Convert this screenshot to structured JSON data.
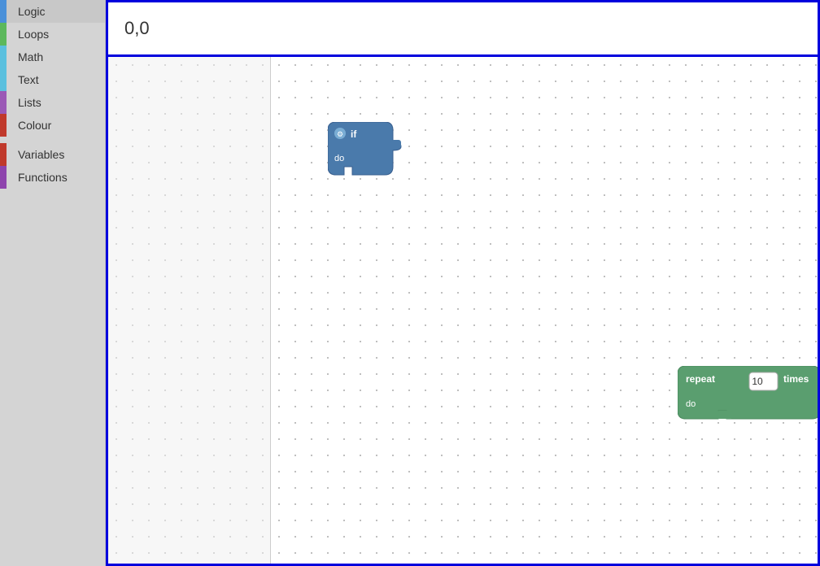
{
  "sidebar": {
    "items": [
      {
        "id": "logic",
        "label": "Logic",
        "color": "#4a90d9"
      },
      {
        "id": "loops",
        "label": "Loops",
        "color": "#5cb85c"
      },
      {
        "id": "math",
        "label": "Math",
        "color": "#5bc0de"
      },
      {
        "id": "text",
        "label": "Text",
        "color": "#5bc0de"
      },
      {
        "id": "lists",
        "label": "Lists",
        "color": "#9b59b6"
      },
      {
        "id": "colour",
        "label": "Colour",
        "color": "#c0392b"
      },
      {
        "id": "variables",
        "label": "Variables",
        "color": "#c0392b"
      },
      {
        "id": "functions",
        "label": "Functions",
        "color": "#8e44ad"
      }
    ]
  },
  "coords": {
    "display": "0,0"
  },
  "blocks": {
    "if_block": {
      "label_if": "if",
      "label_do": "do"
    },
    "repeat_block": {
      "label_repeat": "repeat",
      "label_value": "10",
      "label_times": "times",
      "label_do": "do"
    }
  }
}
